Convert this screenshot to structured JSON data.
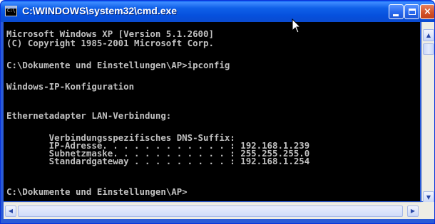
{
  "window": {
    "title": "C:\\WINDOWS\\system32\\cmd.exe",
    "icon_label": "C:\\",
    "buttons": {
      "minimize": "minimize-icon",
      "maximize": "maximize-icon",
      "close_label": "×"
    }
  },
  "console": {
    "lines": [
      "Microsoft Windows XP [Version 5.1.2600]",
      "(C) Copyright 1985-2001 Microsoft Corp.",
      "",
      "C:\\Dokumente und Einstellungen\\AP>ipconfig",
      "",
      "Windows-IP-Konfiguration",
      "",
      "",
      "Ethernetadapter LAN-Verbindung:",
      "",
      "        Verbindungsspezifisches DNS-Suffix:",
      "        IP-Adresse. . . . . . . . . . . . : 192.168.1.239",
      "        Subnetzmaske. . . . . . . . . . . : 255.255.255.0",
      "        Standardgateway . . . . . . . . . : 192.168.1.254",
      "",
      "C:\\Dokumente und Einstellungen\\AP>"
    ]
  },
  "scrollbars": {
    "up_arrow": "▲",
    "down_arrow": "▼",
    "left_arrow": "◀",
    "right_arrow": "▶"
  },
  "colors": {
    "console_background": "#000000",
    "console_text": "#c0c0c0",
    "titlebar_blue": "#0650dd",
    "close_button_red": "#d3532a"
  }
}
